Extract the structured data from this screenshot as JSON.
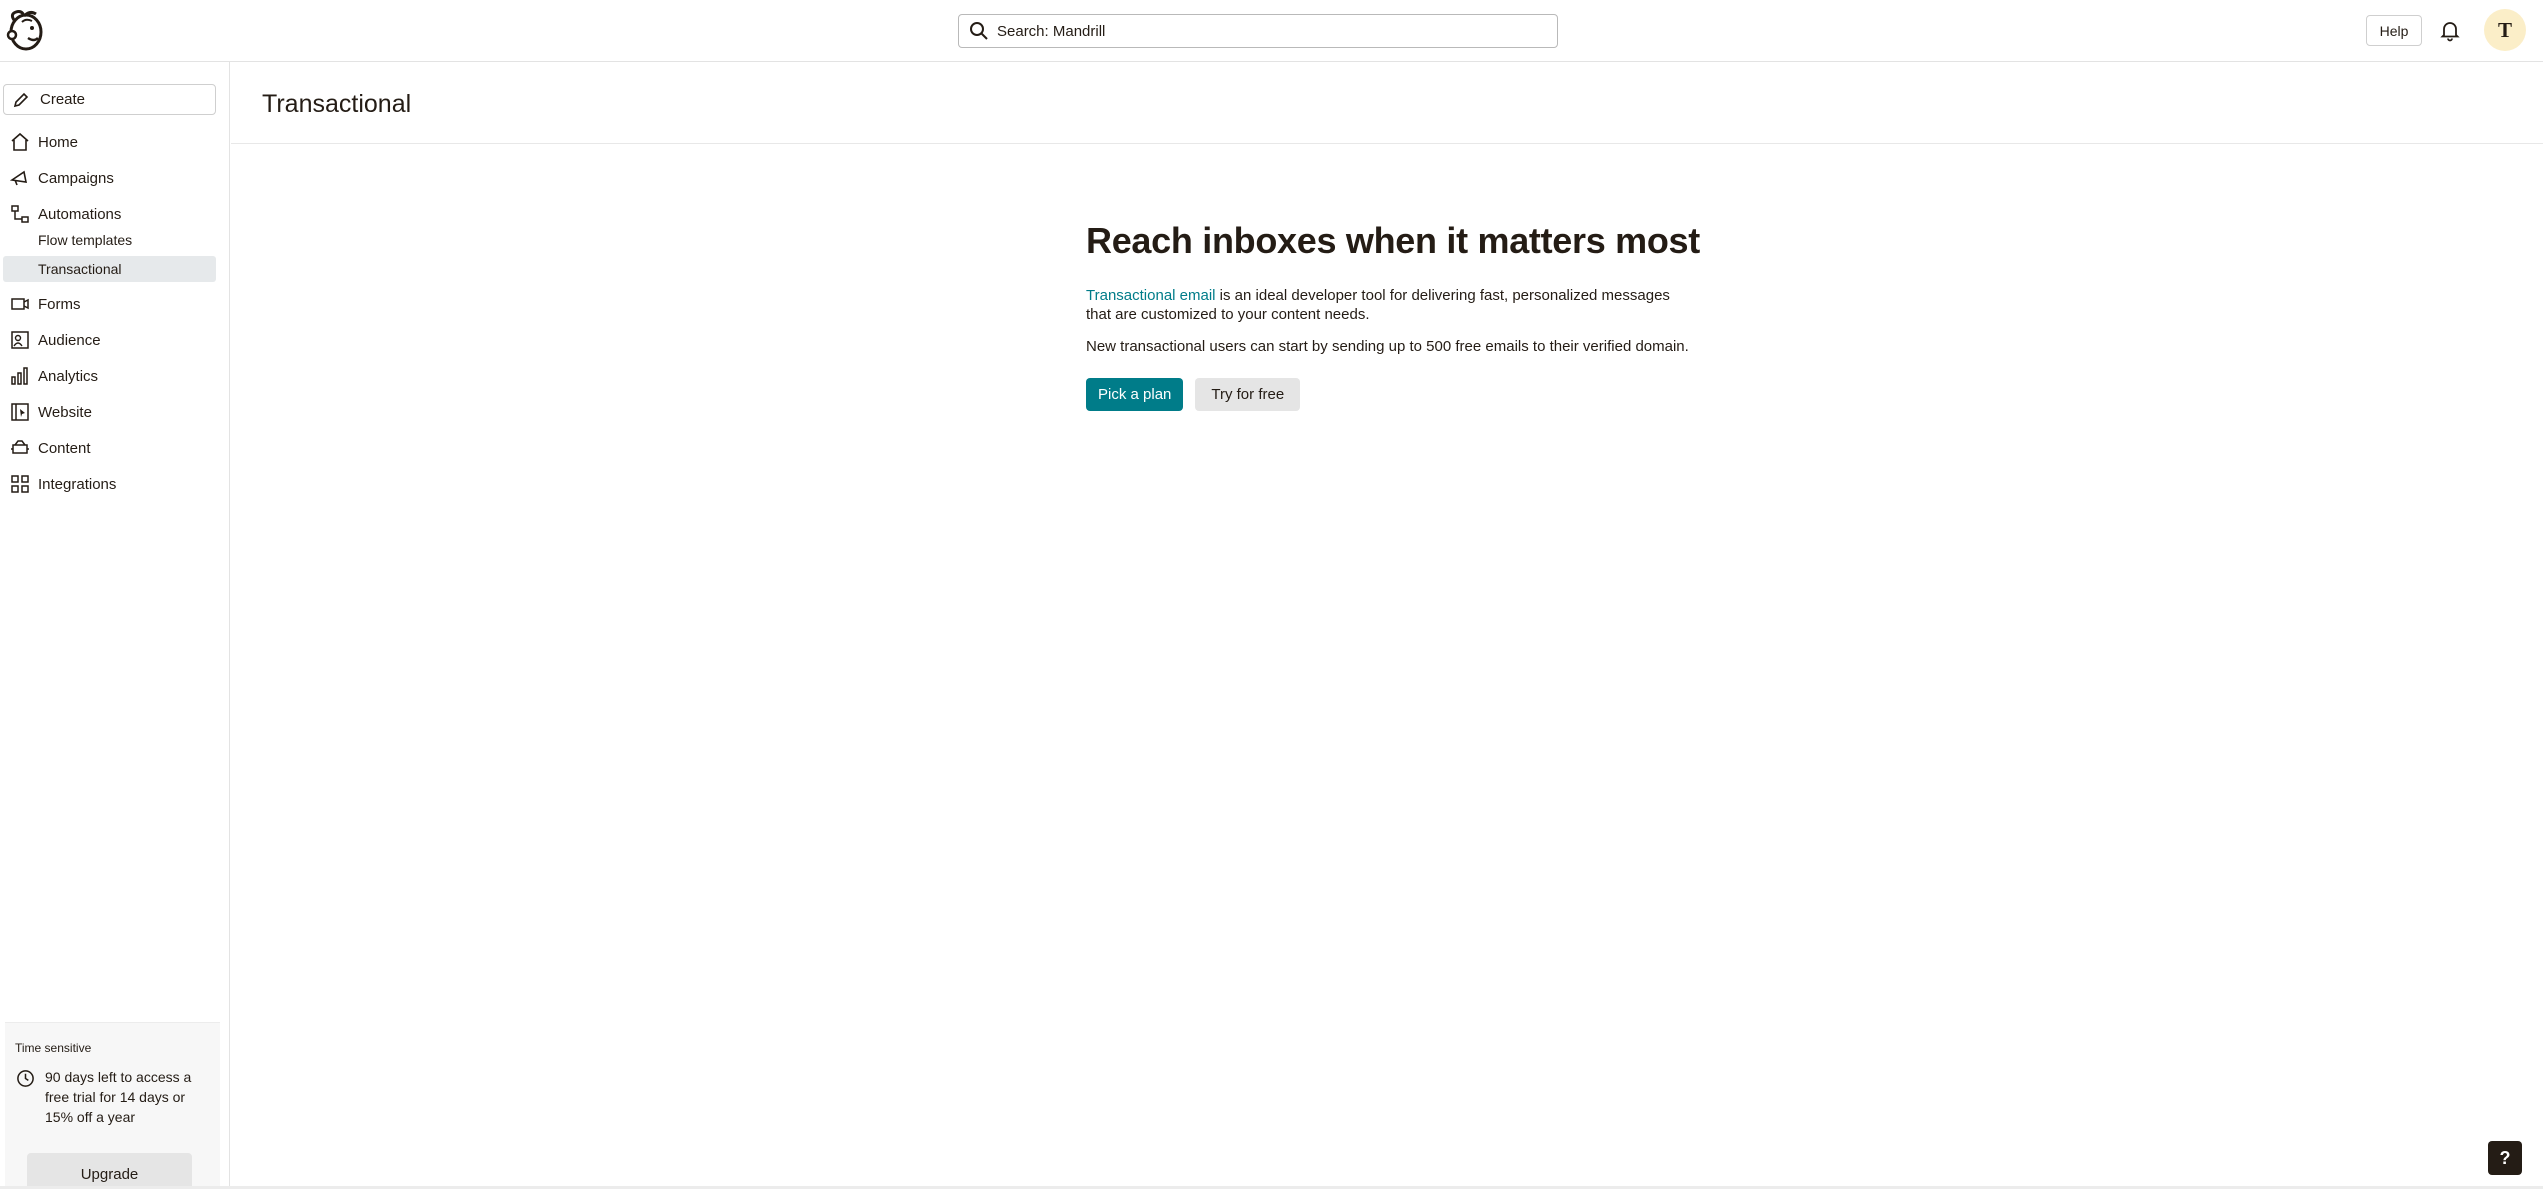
{
  "topbar": {
    "search_placeholder": "Search: Mandrill",
    "help_label": "Help",
    "avatar_initial": "T"
  },
  "sidebar": {
    "create_label": "Create",
    "items": [
      {
        "label": "Home",
        "icon": "home-icon"
      },
      {
        "label": "Campaigns",
        "icon": "megaphone-icon"
      },
      {
        "label": "Automations",
        "icon": "automations-icon"
      },
      {
        "label": "Forms",
        "icon": "forms-icon"
      },
      {
        "label": "Audience",
        "icon": "audience-icon"
      },
      {
        "label": "Analytics",
        "icon": "analytics-icon"
      },
      {
        "label": "Website",
        "icon": "website-icon"
      },
      {
        "label": "Content",
        "icon": "content-icon"
      },
      {
        "label": "Integrations",
        "icon": "integrations-icon"
      }
    ],
    "sub_items": [
      {
        "label": "Flow templates",
        "active": false
      },
      {
        "label": "Transactional",
        "active": true
      }
    ],
    "trial": {
      "heading": "Time sensitive",
      "text": "90 days left to access a free trial for 14 days or 15% off a year",
      "upgrade_label": "Upgrade"
    }
  },
  "main": {
    "page_title": "Transactional",
    "hero": {
      "title": "Reach inboxes when it matters most",
      "link_text": "Transactional email",
      "paragraph1_rest": " is an ideal developer tool for delivering fast, personalized messages that are customized to your content needs.",
      "paragraph2": "New transactional users can start by sending up to 500 free emails to their verified domain.",
      "primary_button": "Pick a plan",
      "secondary_button": "Try for free"
    }
  },
  "help_fab": "?",
  "colors": {
    "accent": "#007c89",
    "text": "#241c15",
    "active_bg": "#e6e9eb",
    "avatar_bg": "#fbeec8"
  }
}
